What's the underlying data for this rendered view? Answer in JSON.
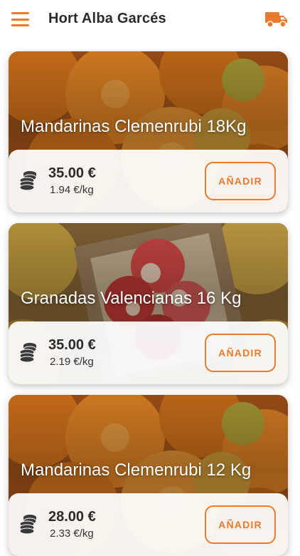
{
  "header": {
    "title": "Hort Alba Garcés",
    "menu_icon": "hamburger-menu-icon",
    "cart_icon": "delivery-truck-icon"
  },
  "colors": {
    "accent": "#ec7a2c",
    "text": "#2b2b2b"
  },
  "products": [
    {
      "name": "Mandarinas Clemenrubi 18Kg",
      "price": "35.00 €",
      "price_per_kg": "1.94 €/kg",
      "button_label": "AÑADIR",
      "image": "mandarins"
    },
    {
      "name": "Granadas Valencianas 16 Kg",
      "price": "35.00 €",
      "price_per_kg": "2.19 €/kg",
      "button_label": "AÑADIR",
      "image": "pomegranates"
    },
    {
      "name": "Mandarinas Clemenrubi 12 Kg",
      "price": "28.00 €",
      "price_per_kg": "2.33 €/kg",
      "button_label": "AÑADIR",
      "image": "mandarins"
    }
  ]
}
